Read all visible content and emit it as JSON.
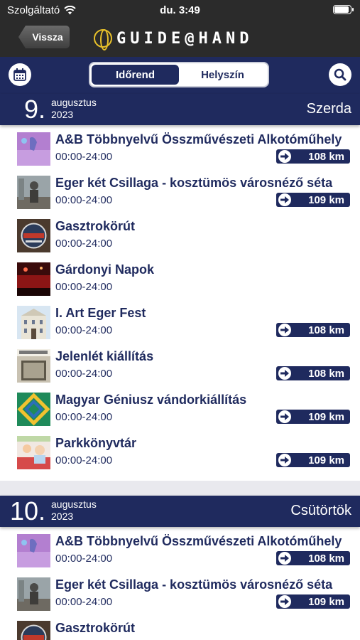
{
  "status": {
    "carrier": "Szolgáltató",
    "time": "du. 3:49"
  },
  "nav": {
    "back_label": "Vissza",
    "logo_text": "GUIDE@HAND"
  },
  "toolbar": {
    "tabs": [
      {
        "label": "Időrend",
        "active": true
      },
      {
        "label": "Helyszín",
        "active": false
      }
    ]
  },
  "days": [
    {
      "num": "9.",
      "month": "augusztus",
      "year": "2023",
      "weekday": "Szerda"
    },
    {
      "num": "10.",
      "month": "augusztus",
      "year": "2023",
      "weekday": "Csütörtök"
    }
  ],
  "events_day1": [
    {
      "title": "A&B Többnyelvű Összművészeti Alkotóműhely",
      "hours": "00:00-24:00",
      "distance": "108 km",
      "thumb": "purple-art"
    },
    {
      "title": "Eger két Csillaga - kosztümös városnéző séta",
      "hours": "00:00-24:00",
      "distance": "109 km",
      "thumb": "statue"
    },
    {
      "title": "Gasztrokörút",
      "hours": "00:00-24:00",
      "distance": "",
      "thumb": "gastro-badge"
    },
    {
      "title": "Gárdonyi Napok",
      "hours": "00:00-24:00",
      "distance": "",
      "thumb": "red-stage"
    },
    {
      "title": "I. Art Eger Fest",
      "hours": "00:00-24:00",
      "distance": "108 km",
      "thumb": "building"
    },
    {
      "title": "Jelenlét kiállítás",
      "hours": "00:00-24:00",
      "distance": "108 km",
      "thumb": "gallery"
    },
    {
      "title": "Magyar Géniusz vándorkiállítás",
      "hours": "00:00-24:00",
      "distance": "109 km",
      "thumb": "green-logo"
    },
    {
      "title": "Parkkönyvtár",
      "hours": "00:00-24:00",
      "distance": "109 km",
      "thumb": "kids"
    }
  ],
  "events_day2": [
    {
      "title": "A&B Többnyelvű Összművészeti Alkotóműhely",
      "hours": "00:00-24:00",
      "distance": "108 km",
      "thumb": "purple-art"
    },
    {
      "title": "Eger két Csillaga - kosztümös városnéző séta",
      "hours": "00:00-24:00",
      "distance": "109 km",
      "thumb": "statue"
    },
    {
      "title": "Gasztrokörút",
      "hours": "",
      "distance": "",
      "thumb": "gastro-badge"
    }
  ],
  "colors": {
    "navy": "#1f2a5e",
    "dark_bar": "#2b2b2b",
    "logo_gold": "#e8c12a"
  }
}
